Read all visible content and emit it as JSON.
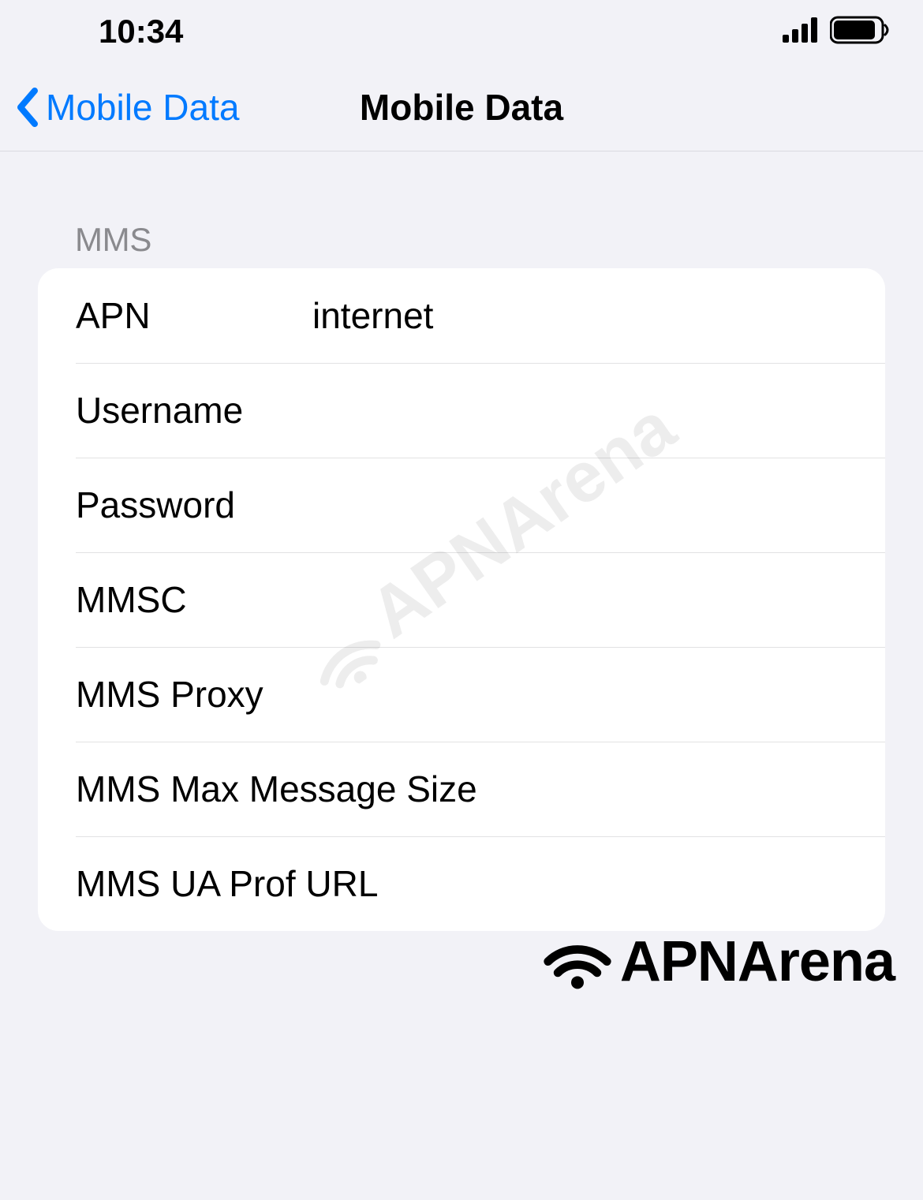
{
  "status": {
    "time": "10:34"
  },
  "nav": {
    "back_label": "Mobile Data",
    "title": "Mobile Data"
  },
  "section_header": "MMS",
  "fields": {
    "apn": {
      "label": "APN",
      "value": "internet"
    },
    "username": {
      "label": "Username",
      "value": ""
    },
    "password": {
      "label": "Password",
      "value": ""
    },
    "mmsc": {
      "label": "MMSC",
      "value": ""
    },
    "mms_proxy": {
      "label": "MMS Proxy",
      "value": ""
    },
    "mms_max_message_size": {
      "label": "MMS Max Message Size",
      "value": ""
    },
    "mms_ua_prof_url": {
      "label": "MMS UA Prof URL",
      "value": ""
    }
  },
  "watermark": "APNArena"
}
